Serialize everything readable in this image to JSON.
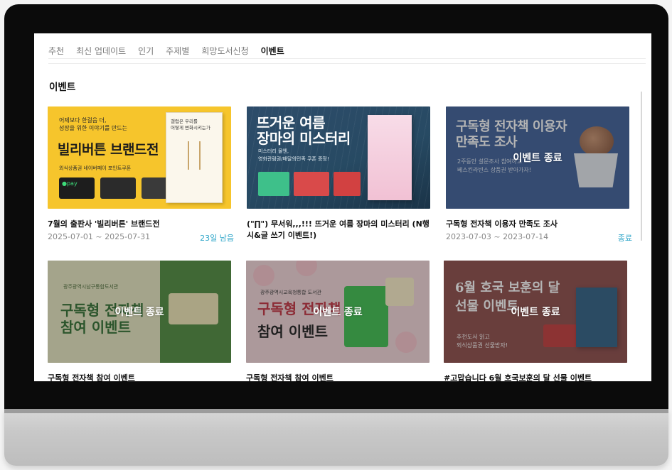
{
  "nav": {
    "items": [
      "추천",
      "최신 업데이트",
      "인기",
      "주제별",
      "희망도서신청",
      "이벤트"
    ],
    "active_index": 5
  },
  "section_title": "이벤트",
  "ended_label": "이벤트 종료",
  "cards": [
    {
      "title": "7월의 출판사 '빌리버튼' 브랜드전",
      "date": "2025-07-01 ~ 2025-07-31",
      "status": "23일 남음",
      "ended": false,
      "banner": {
        "small": "어제보다 한걸음 더,\n성장을 위한 이야기를 만드는",
        "big": "빌리버튼 브랜드전",
        "line": "외식상품권 네이버페이 포인트쿠폰",
        "book": "갤럽은 우리를\n어떻게 변화시키는가"
      }
    },
    {
      "title": "(\"∏\") 무서워,,,!!! 뜨거운 여름 장마의 미스터리 (N행시&글 쓰기 이벤트!)",
      "date": "",
      "status": "",
      "ended": false,
      "banner": {
        "big": "뜨거운 여름\n장마의 미스터리",
        "small": "미스터리 물엔,\n영화관람권/배달의민족 쿠폰 증정!"
      }
    },
    {
      "title": "구독형 전자책 이용자 만족도 조사",
      "date": "2023-07-03 ~ 2023-07-14",
      "status": "종료",
      "ended": true,
      "banner": {
        "big": "구독형 전자책 이용자\n만족도 조사",
        "small": "2주동안 설문조사 참여하고\n베스킨라빈스 상품권 받아가자!"
      }
    },
    {
      "title": "구독형 전자책 참여 이벤트",
      "ended": true,
      "banner": {
        "small": "광주광역시남구통합도서관",
        "big": "구독형 전자책\n참여 이벤트"
      }
    },
    {
      "title": "구독형 전자책 참여 이벤트",
      "ended": true,
      "banner": {
        "small": "광주광역시교육청통합 도서관",
        "big": "구독형 전자책",
        "big2": "참여 이벤트"
      }
    },
    {
      "title": "#고맙습니다 6월 호국보훈의 달 선물 이벤트",
      "ended": true,
      "banner": {
        "big": "6월 호국 보훈의 달\n선물 이벤트",
        "small": "추천도서 읽고\n외식상품권 선물받자!"
      }
    }
  ]
}
